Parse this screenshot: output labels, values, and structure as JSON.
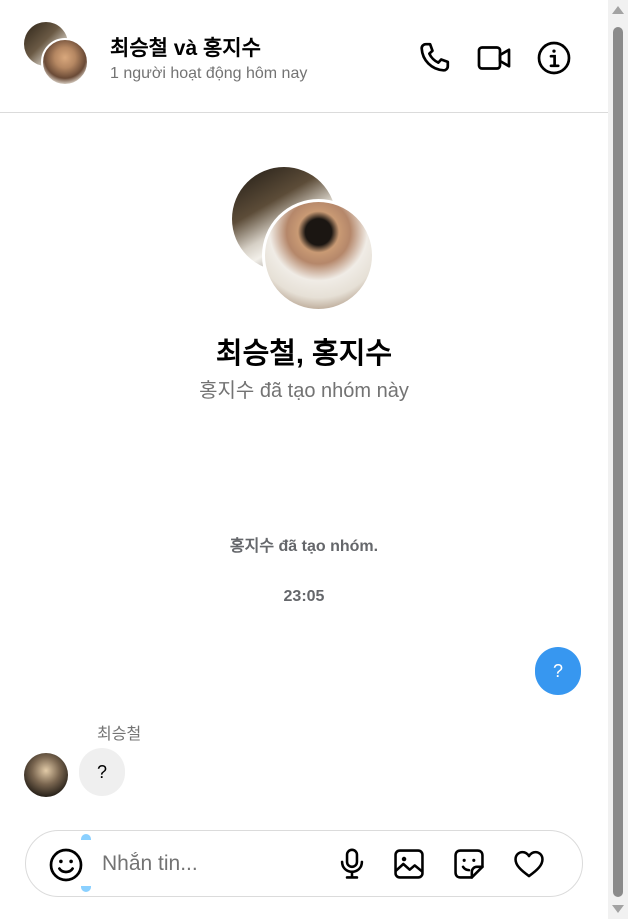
{
  "header": {
    "title": "최승철 và 홍지수",
    "subtitle": "1 người hoạt động hôm nay",
    "icons": [
      "phone-icon",
      "video-camera-icon",
      "info-icon"
    ]
  },
  "intro": {
    "title": "최승철, 홍지수",
    "subtitle": "홍지수 đã tạo nhóm này"
  },
  "conversation": {
    "system_message": "홍지수 đã tạo nhóm.",
    "timestamp": "23:05",
    "messages": [
      {
        "direction": "outgoing",
        "text": "?"
      },
      {
        "direction": "incoming",
        "sender": "최승철",
        "text": "?"
      }
    ]
  },
  "composer": {
    "placeholder": "Nhắn tin...",
    "icons": [
      "emoji-icon",
      "microphone-icon",
      "image-icon",
      "sticker-icon",
      "heart-icon"
    ]
  },
  "colors": {
    "accent": "#3797f0",
    "incoming_bubble": "#efefef",
    "secondary_text": "#737373"
  }
}
